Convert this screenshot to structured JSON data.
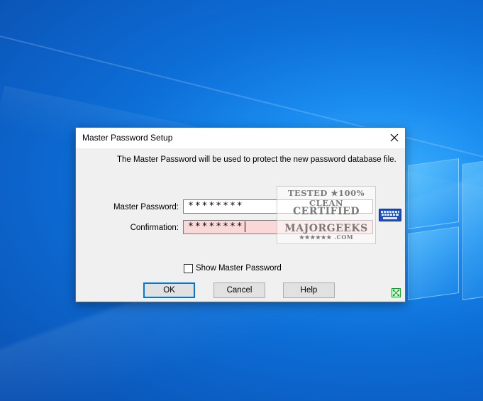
{
  "window": {
    "title": "Master Password Setup",
    "close_icon": "close-icon"
  },
  "description": "The Master Password will be used to protect the new password database file.",
  "fields": {
    "master_label": "Master Password:",
    "master_value": "********",
    "confirm_label": "Confirmation:",
    "confirm_value": "********"
  },
  "keyboard_icon": "keyboard-icon",
  "watermark": {
    "line1": "TESTED ★100% CLEAN",
    "line2": "CERTIFIED",
    "line3": "MAJORGEEKS",
    "line4": "★★★★★★ .COM"
  },
  "show_password": {
    "label": "Show Master Password",
    "checked": false
  },
  "buttons": {
    "ok": "OK",
    "cancel": "Cancel",
    "help": "Help"
  },
  "colors": {
    "confirm_field_bg": "#fbd8d8",
    "ok_border": "#0078d7",
    "desktop_blue": "#0d6fd8"
  }
}
